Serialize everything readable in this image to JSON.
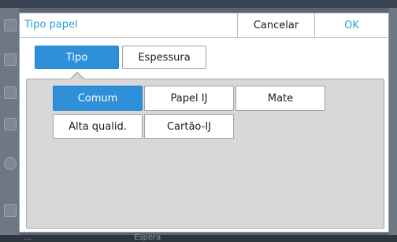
{
  "dialog": {
    "title": "Tipo papel",
    "cancel_label": "Cancelar",
    "ok_label": "OK"
  },
  "tabs": [
    {
      "label": "Tipo",
      "active": true
    },
    {
      "label": "Espessura",
      "active": false
    }
  ],
  "options": [
    {
      "label": "Comum",
      "selected": true
    },
    {
      "label": "Papel IJ",
      "selected": false
    },
    {
      "label": "Mate",
      "selected": false
    },
    {
      "label": "Alta qualid.",
      "selected": false
    },
    {
      "label": "Cartão-IJ",
      "selected": false
    }
  ],
  "background": {
    "bottom_left_text": "...",
    "bottom_mid_text": "Espera"
  },
  "colors": {
    "accent": "#2e90d9",
    "title_text": "#2aa0d8",
    "panel": "#d8d8d8"
  }
}
